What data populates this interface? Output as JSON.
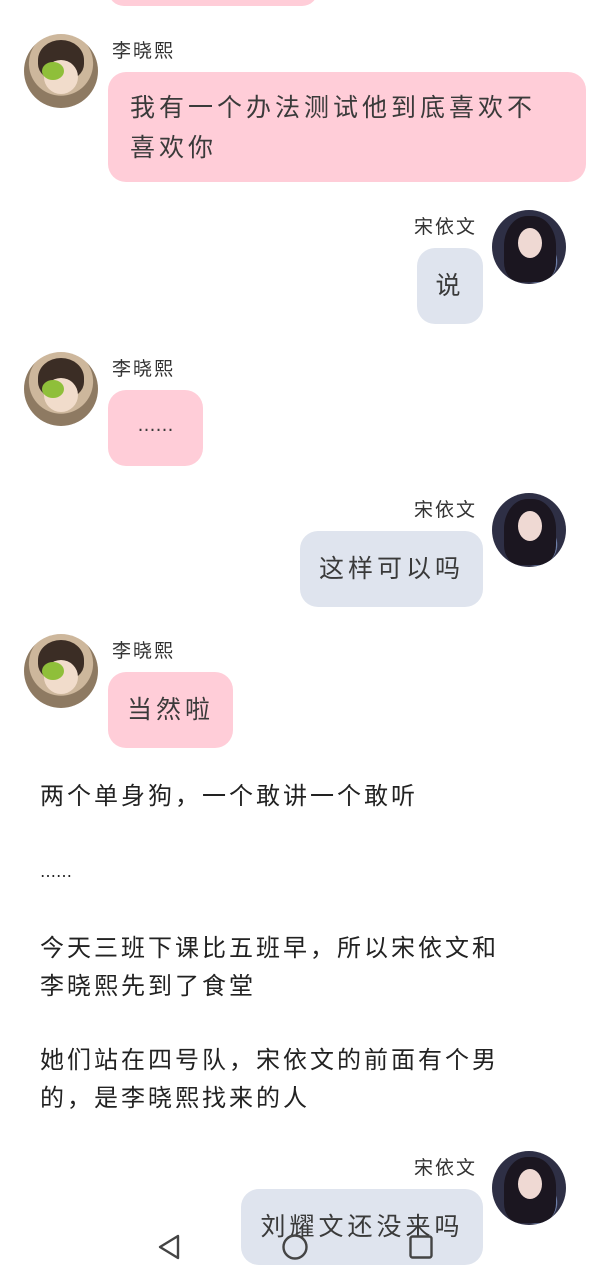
{
  "messages": {
    "m1": {
      "sender": "李晓熙",
      "text": "我有一个办法测试他到底喜欢不喜欢你"
    },
    "m2": {
      "sender": "宋依文",
      "text": "说"
    },
    "m3": {
      "sender": "李晓熙",
      "text": "……"
    },
    "m4": {
      "sender": "宋依文",
      "text": "这样可以吗"
    },
    "m5": {
      "sender": "李晓熙",
      "text": "当然啦"
    },
    "m6": {
      "sender": "宋依文",
      "text": "刘耀文还没来吗"
    }
  },
  "narration": {
    "n1": "两个单身狗，一个敢讲一个敢听",
    "n2": "……",
    "n3a": "今天三班下课比五班早，所以宋依文和",
    "n3b": "李晓熙先到了食堂",
    "n4a": "她们站在四号队，宋依文的前面有个男",
    "n4b": "的，是李晓熙找来的人"
  },
  "colors": {
    "left_bubble": "#ffcdd8",
    "right_bubble": "#dfe4ee"
  },
  "icons": {
    "back": "triangle-back-icon",
    "home": "circle-home-icon",
    "recents": "square-recents-icon"
  }
}
